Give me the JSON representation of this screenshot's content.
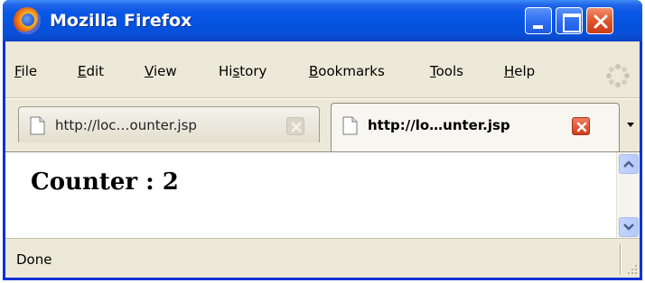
{
  "window": {
    "title": "Mozilla Firefox",
    "app_icon": "firefox-logo"
  },
  "menubar": {
    "items": [
      {
        "label": "File",
        "accel": "F",
        "rest": "ile"
      },
      {
        "label": "Edit",
        "accel": "E",
        "rest": "dit"
      },
      {
        "label": "View",
        "accel": "V",
        "rest": "iew"
      },
      {
        "label": "History",
        "pre": "Hi",
        "accel": "s",
        "rest": "tory"
      },
      {
        "label": "Bookmarks",
        "accel": "B",
        "rest": "ookmarks"
      },
      {
        "label": "Tools",
        "accel": "T",
        "rest": "ools"
      },
      {
        "label": "Help",
        "accel": "H",
        "rest": "elp"
      }
    ]
  },
  "tabs": [
    {
      "label": "http://loc…ounter.jsp",
      "active": false,
      "icon": "document-icon"
    },
    {
      "label": "http://lo…unter.jsp",
      "active": true,
      "icon": "document-icon"
    }
  ],
  "page": {
    "heading": "Counter : 2"
  },
  "statusbar": {
    "text": "Done"
  },
  "colors": {
    "titlebar": "#0553e0",
    "chrome": "#ece9d8",
    "close_button": "#e3572e"
  }
}
